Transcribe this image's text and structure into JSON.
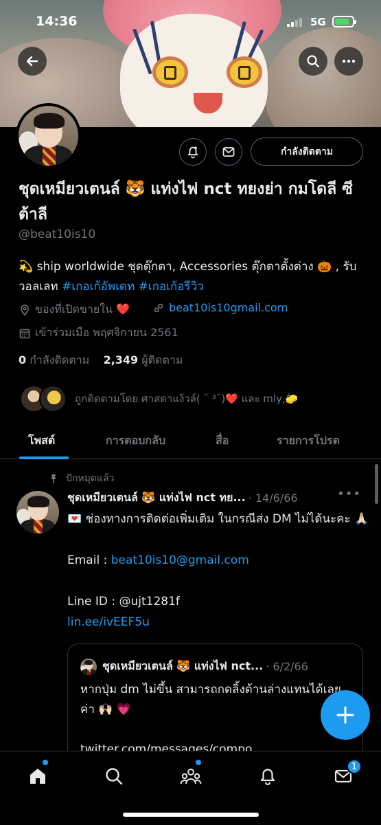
{
  "status_bar": {
    "time": "14:36",
    "network": "5G"
  },
  "header": {},
  "profile": {
    "following_button": "กำลังติดตาม",
    "name": "ชุดเหมียวเตนล์ 🐯 แท่งไฟ nct ทยงย่า กมโดลี ซีต้าลี",
    "handle": "@beat10is10",
    "bio_prefix": "💫 ship worldwide ชุดตุ๊กตา, Accessories ตุ๊กตาตั้งต่าง 🎃 , รับวอลเลท ",
    "bio_tag1": "#เกอเก้อัพเดท",
    "bio_tag2": "#เกอเก้อรีวิว",
    "location": "ของที่เปิดขายใน ❤️",
    "website": "beat10is10gmail.com",
    "joined": "เข้าร่วมเมือ พฤศจิกายน 2561",
    "following_count": "0",
    "following_label": "กำลังติดตาม",
    "followers_count": "2,349",
    "followers_label": "ผู้ติดตาม",
    "followed_by": "ถูกติดตามโดย ศาสดาแง้วล์( ˘ ³˘)❤️ และ mly,🧽"
  },
  "tabs": [
    {
      "label": "โพสต์",
      "active": true
    },
    {
      "label": "การตอบกลับ",
      "active": false
    },
    {
      "label": "สื่อ",
      "active": false
    },
    {
      "label": "รายการโปรด",
      "active": false
    }
  ],
  "post": {
    "pinned_label": "ปักหมุดแล้ว",
    "author": "ชุดเหมียวเตนล์ 🐯 แท่งไฟ nct ทย...",
    "date": "· 14/6/66",
    "line1": "💌 ช่องทางการติดต่อเพิ่มเติม ในกรณีส่ง DM ไม่ได้นะคะ 🙏🏻",
    "email_label": "Email : ",
    "email": "beat10is10@gmail.com",
    "line_id": "Line ID : @ujt1281f",
    "line_link": "lin.ee/ivEEF5u",
    "quote": {
      "author": "ชุดเหมียวเตนล์ 🐯 แท่งไฟ nct...",
      "date": "· 6/2/66",
      "text": "หากปุ่ม dm ไม่ขึ้น สามารถกดลิ้งด้านล่างแทนได้เลยค่า 🙌🏻 💗",
      "link": "twitter.com/messages/compo..."
    }
  },
  "fab_label": "+",
  "bottom_nav": {
    "messages_badge": "1"
  },
  "colors": {
    "accent": "#1d9bf0",
    "background": "#000000",
    "muted": "#71767b"
  }
}
